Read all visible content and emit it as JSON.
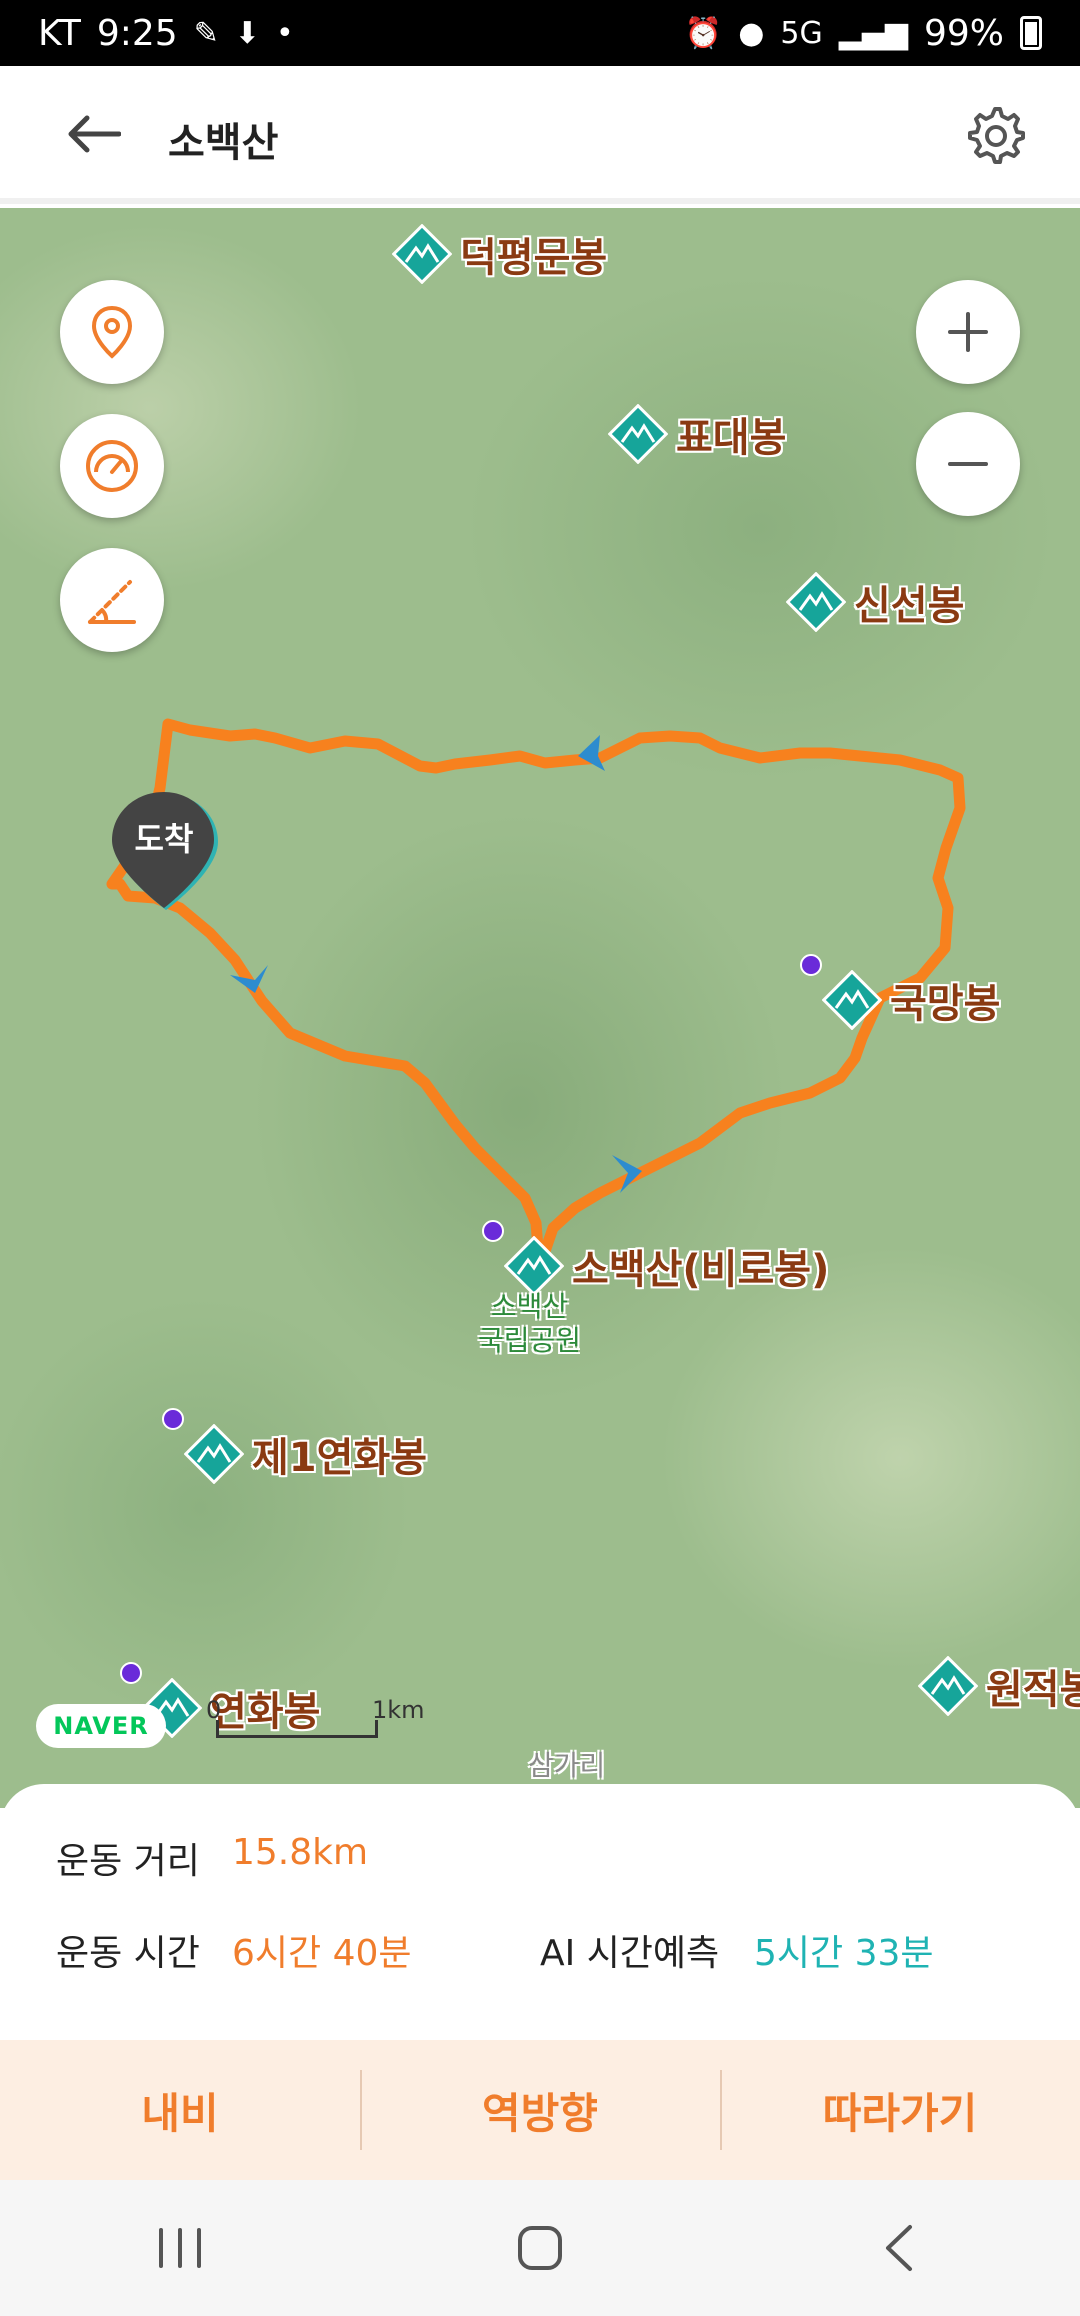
{
  "status_bar": {
    "carrier": "KT",
    "time": "9:25",
    "network": "5G",
    "battery": "99%"
  },
  "header": {
    "title": "소백산"
  },
  "map": {
    "peaks": [
      {
        "name": "덕평문봉",
        "badge": false
      },
      {
        "name": "표대봉",
        "badge": false
      },
      {
        "name": "신선봉",
        "badge": false
      },
      {
        "name": "국망봉",
        "badge": true
      },
      {
        "name": "소백산(비로봉)",
        "badge": true
      },
      {
        "name": "제1연화봉",
        "badge": true
      },
      {
        "name": "연화봉",
        "badge": true
      },
      {
        "name": "원적봉",
        "badge": false
      }
    ],
    "park_label_line1": "소백산",
    "park_label_line2": "국립공원",
    "place_label": "삼가리",
    "arrival_pin_label": "도착",
    "scale_start": "0",
    "scale_end": "1km",
    "provider": "NAVER",
    "route_color": "#f7811e"
  },
  "stats": {
    "distance_label": "운동 거리",
    "distance_value": "15.8km",
    "time_label": "운동 시간",
    "time_value": "6시간 40분",
    "ai_label": "AI 시간예측",
    "ai_value": "5시간 33분"
  },
  "actions": {
    "navi": "내비",
    "reverse": "역방향",
    "follow": "따라가기"
  },
  "colors": {
    "accent": "#f07d2c",
    "teal": "#1fb3b3",
    "peak_label": "#8a3a12"
  }
}
